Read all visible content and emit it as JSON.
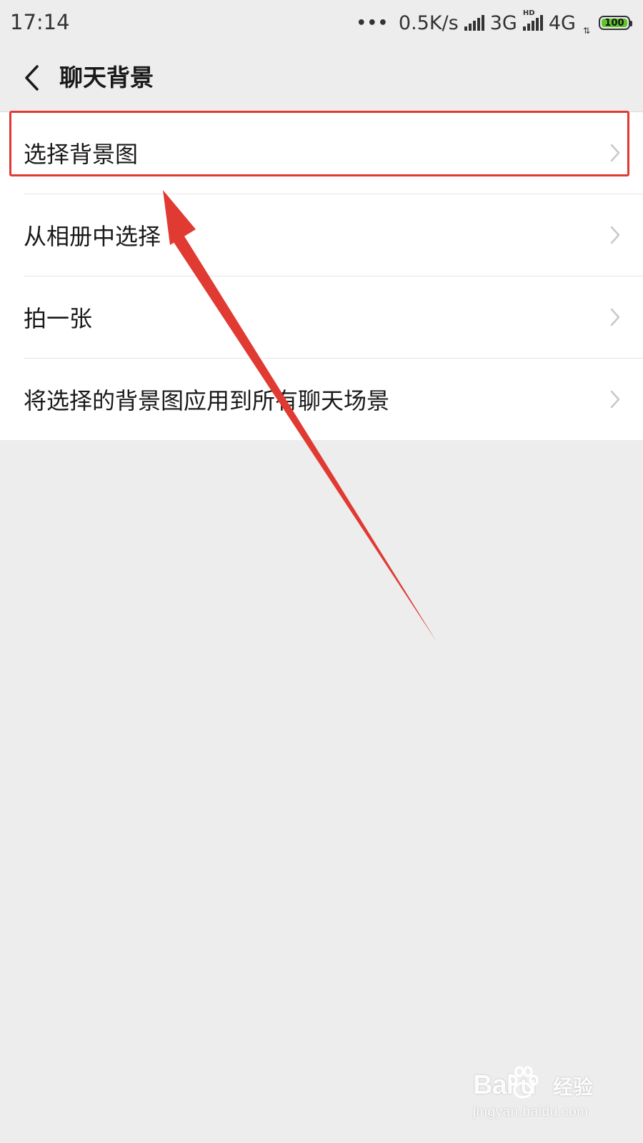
{
  "status_bar": {
    "time": "17:14",
    "dots": "•••",
    "net_speed": "0.5K/s",
    "net_3g": "3G",
    "hd_label": "HD",
    "net_4g": "4G",
    "data_arrows": "⇅",
    "battery": "100",
    "battery_color": "#5fc42e"
  },
  "nav": {
    "back_icon": "chevron-left-icon",
    "title": "聊天背景"
  },
  "menu": {
    "items": [
      {
        "label": "选择背景图"
      },
      {
        "label": "从相册中选择"
      },
      {
        "label": "拍一张"
      },
      {
        "label": "将选择的背景图应用到所有聊天场景"
      }
    ],
    "chevron_icon": "chevron-right-icon"
  },
  "annotation": {
    "color": "#e03a32"
  },
  "watermark": {
    "logo_text": "Bai  u",
    "paw_icon": "paw-icon",
    "brand_suffix": "经验",
    "url": "jingyan.baidu.com"
  }
}
